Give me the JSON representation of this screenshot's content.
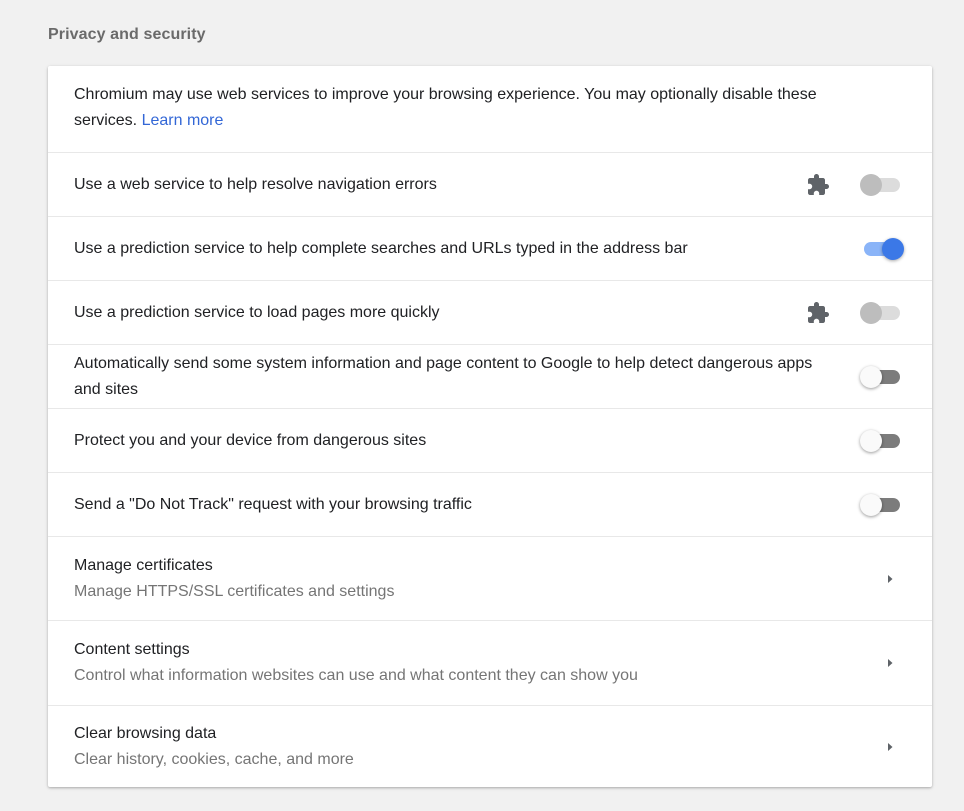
{
  "section_title": "Privacy and security",
  "intro": {
    "text": "Chromium may use web services to improve your browsing experience. You may optionally disable these services. ",
    "link": "Learn more"
  },
  "toggles": [
    {
      "label": "Use a web service to help resolve navigation errors",
      "state": "off",
      "disabled": true,
      "extension_icon": "puzzle-piece-icon"
    },
    {
      "label": "Use a prediction service to help complete searches and URLs typed in the address bar",
      "state": "on",
      "disabled": false
    },
    {
      "label": "Use a prediction service to load pages more quickly",
      "state": "off",
      "disabled": true,
      "extension_icon": "puzzle-piece-icon"
    },
    {
      "label": "Automatically send some system information and page content to Google to help detect dangerous apps and sites",
      "state": "off",
      "disabled": false
    },
    {
      "label": "Protect you and your device from dangerous sites",
      "state": "off",
      "disabled": false
    },
    {
      "label": "Send a \"Do Not Track\" request with your browsing traffic",
      "state": "off",
      "disabled": false
    }
  ],
  "links": [
    {
      "title": "Manage certificates",
      "subtitle": "Manage HTTPS/SSL certificates and settings",
      "icon": "arrow-right-icon"
    },
    {
      "title": "Content settings",
      "subtitle": "Control what information websites can use and what content they can show you",
      "icon": "arrow-right-icon"
    },
    {
      "title": "Clear browsing data",
      "subtitle": "Clear history, cookies, cache, and more",
      "icon": "arrow-right-icon"
    }
  ],
  "colors": {
    "link": "#3367d6",
    "toggle_on": "#3b78e7",
    "secondary_text": "#757575"
  }
}
